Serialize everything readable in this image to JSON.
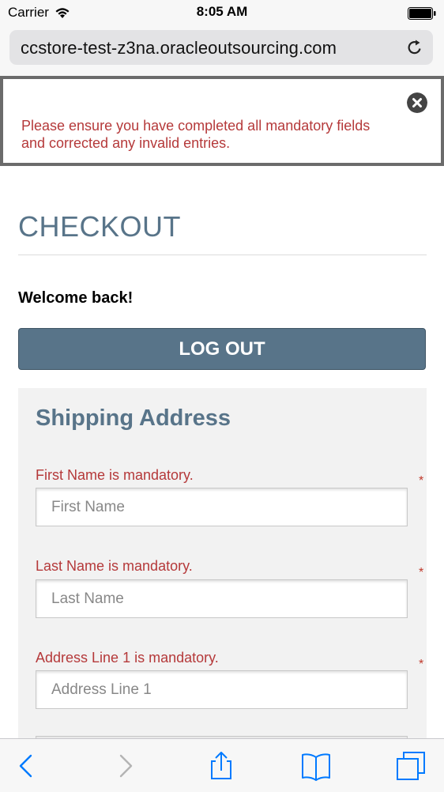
{
  "status_bar": {
    "carrier": "Carrier",
    "time": "8:05 AM"
  },
  "browser": {
    "url": "ccstore-test-z3na.oracleoutsourcing.com"
  },
  "error_banner": {
    "message": "Please ensure you have completed all mandatory fields and corrected any invalid entries."
  },
  "page": {
    "title": "CHECKOUT",
    "welcome": "Welcome back!",
    "logout_label": "LOG OUT"
  },
  "shipping": {
    "title": "Shipping Address",
    "fields": [
      {
        "error": "First Name is mandatory.",
        "placeholder": "First Name",
        "required_mark": "*"
      },
      {
        "error": "Last Name is mandatory.",
        "placeholder": "Last Name",
        "required_mark": "*"
      },
      {
        "error": "Address Line 1 is mandatory.",
        "placeholder": "Address Line 1",
        "required_mark": "*"
      }
    ]
  },
  "toolbar": {
    "icons": [
      "back-icon",
      "forward-icon",
      "share-icon",
      "bookmarks-icon",
      "tabs-icon"
    ]
  },
  "colors": {
    "accent": "#587489",
    "error": "#b5393a",
    "ios_blue": "#007aff"
  }
}
